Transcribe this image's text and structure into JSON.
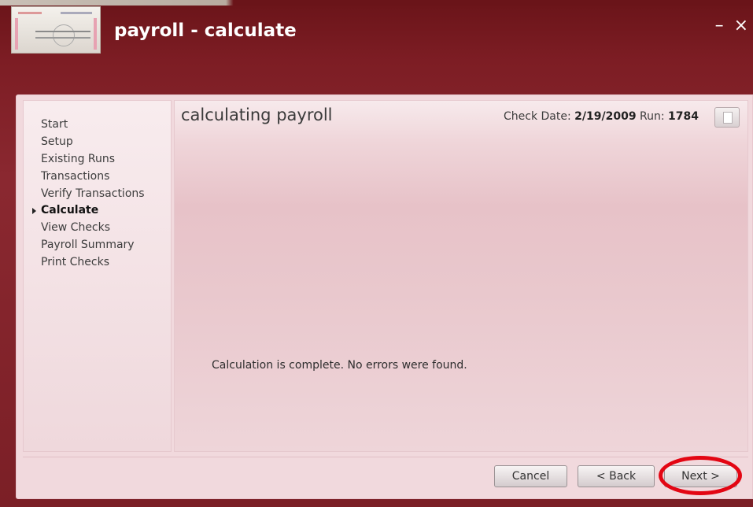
{
  "window": {
    "title": "payroll - calculate",
    "minimize_label": "–",
    "close_label": "×"
  },
  "sidebar": {
    "items": [
      {
        "label": "Start",
        "active": false
      },
      {
        "label": "Setup",
        "active": false
      },
      {
        "label": "Existing Runs",
        "active": false
      },
      {
        "label": "Transactions",
        "active": false
      },
      {
        "label": "Verify Transactions",
        "active": false
      },
      {
        "label": "Calculate",
        "active": true
      },
      {
        "label": "View Checks",
        "active": false
      },
      {
        "label": "Payroll Summary",
        "active": false
      },
      {
        "label": "Print Checks",
        "active": false
      }
    ]
  },
  "content": {
    "title": "calculating payroll",
    "check_date_label": "Check Date:",
    "check_date_value": "2/19/2009",
    "run_label": "Run:",
    "run_value": "1784",
    "message": "Calculation is complete.  No errors were found."
  },
  "footer": {
    "cancel_label": "Cancel",
    "back_label": "< Back",
    "next_label": "Next >"
  },
  "colors": {
    "titlebar": "#7a1e24",
    "panel": "#f1d9dd",
    "highlight": "#e30613"
  },
  "icons": {
    "print": "print-icon",
    "arrow": "current-step-arrow-icon"
  }
}
